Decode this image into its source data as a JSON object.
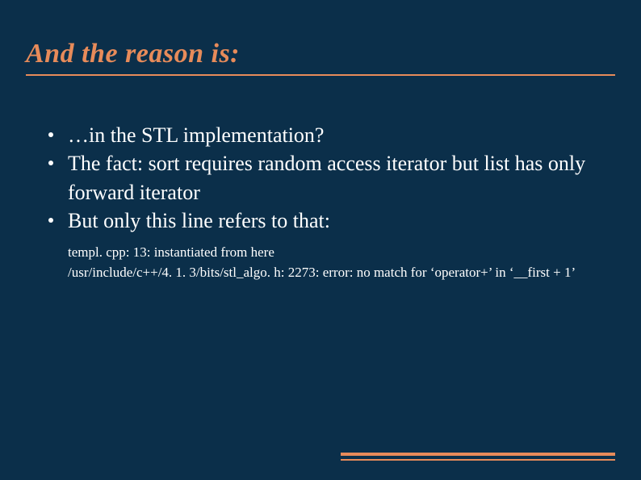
{
  "slide": {
    "title": "And the reason is:",
    "bullets": [
      "…in the STL implementation?",
      "The fact: sort requires random access iterator but list has only forward iterator",
      "But only this line refers to that:"
    ],
    "code": {
      "line1": "templ. cpp: 13:   instantiated from here",
      "line2": "/usr/include/c++/4. 1. 3/bits/stl_algo. h: 2273: error: no match for ‘operator+’ in ‘__first + 1’"
    },
    "accent_color": "#e78b5a",
    "background_color": "#0b2f4a"
  }
}
